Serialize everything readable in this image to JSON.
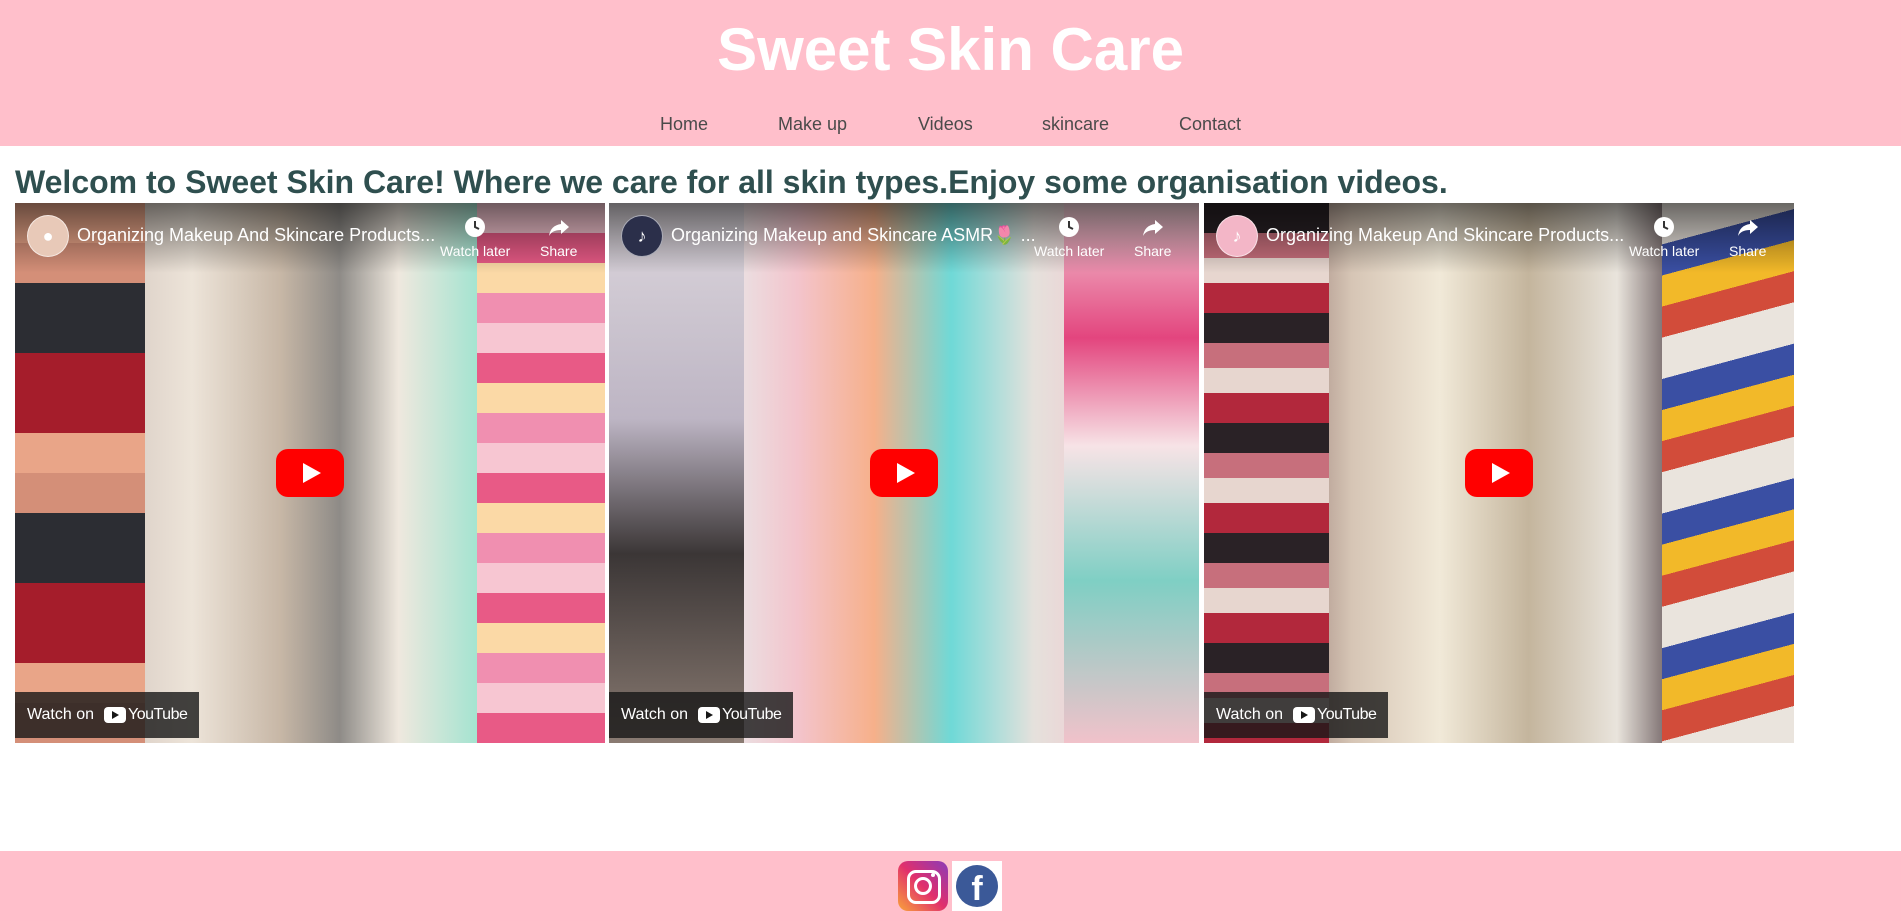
{
  "site": {
    "title": "Sweet Skin Care"
  },
  "nav": {
    "items": [
      {
        "label": "Home"
      },
      {
        "label": "Make up"
      },
      {
        "label": "Videos"
      },
      {
        "label": "skincare"
      },
      {
        "label": "Contact"
      }
    ]
  },
  "main": {
    "heading": "Welcom to Sweet Skin Care! Where we care for all skin types.Enjoy some organisation videos."
  },
  "videos": [
    {
      "title": "Organizing Makeup And Skincare Products...",
      "watch_later": "Watch later",
      "share": "Share",
      "watch_on": "Watch on",
      "platform": "YouTube"
    },
    {
      "title": "Organizing Makeup and Skincare ASMR🌷 ...",
      "watch_later": "Watch later",
      "share": "Share",
      "watch_on": "Watch on",
      "platform": "YouTube"
    },
    {
      "title": "Organizing Makeup And Skincare Products...",
      "watch_later": "Watch later",
      "share": "Share",
      "watch_on": "Watch on",
      "platform": "YouTube"
    }
  ],
  "footer": {
    "social": [
      {
        "icon": "instagram-icon"
      },
      {
        "icon": "facebook-icon",
        "glyph": "f"
      }
    ]
  },
  "colors": {
    "header_bg": "#ffbfcb",
    "title_text": "#ffffff",
    "heading_text": "#2f4f4f",
    "nav_text": "#4a4a4a",
    "play_button": "#ff0000"
  }
}
